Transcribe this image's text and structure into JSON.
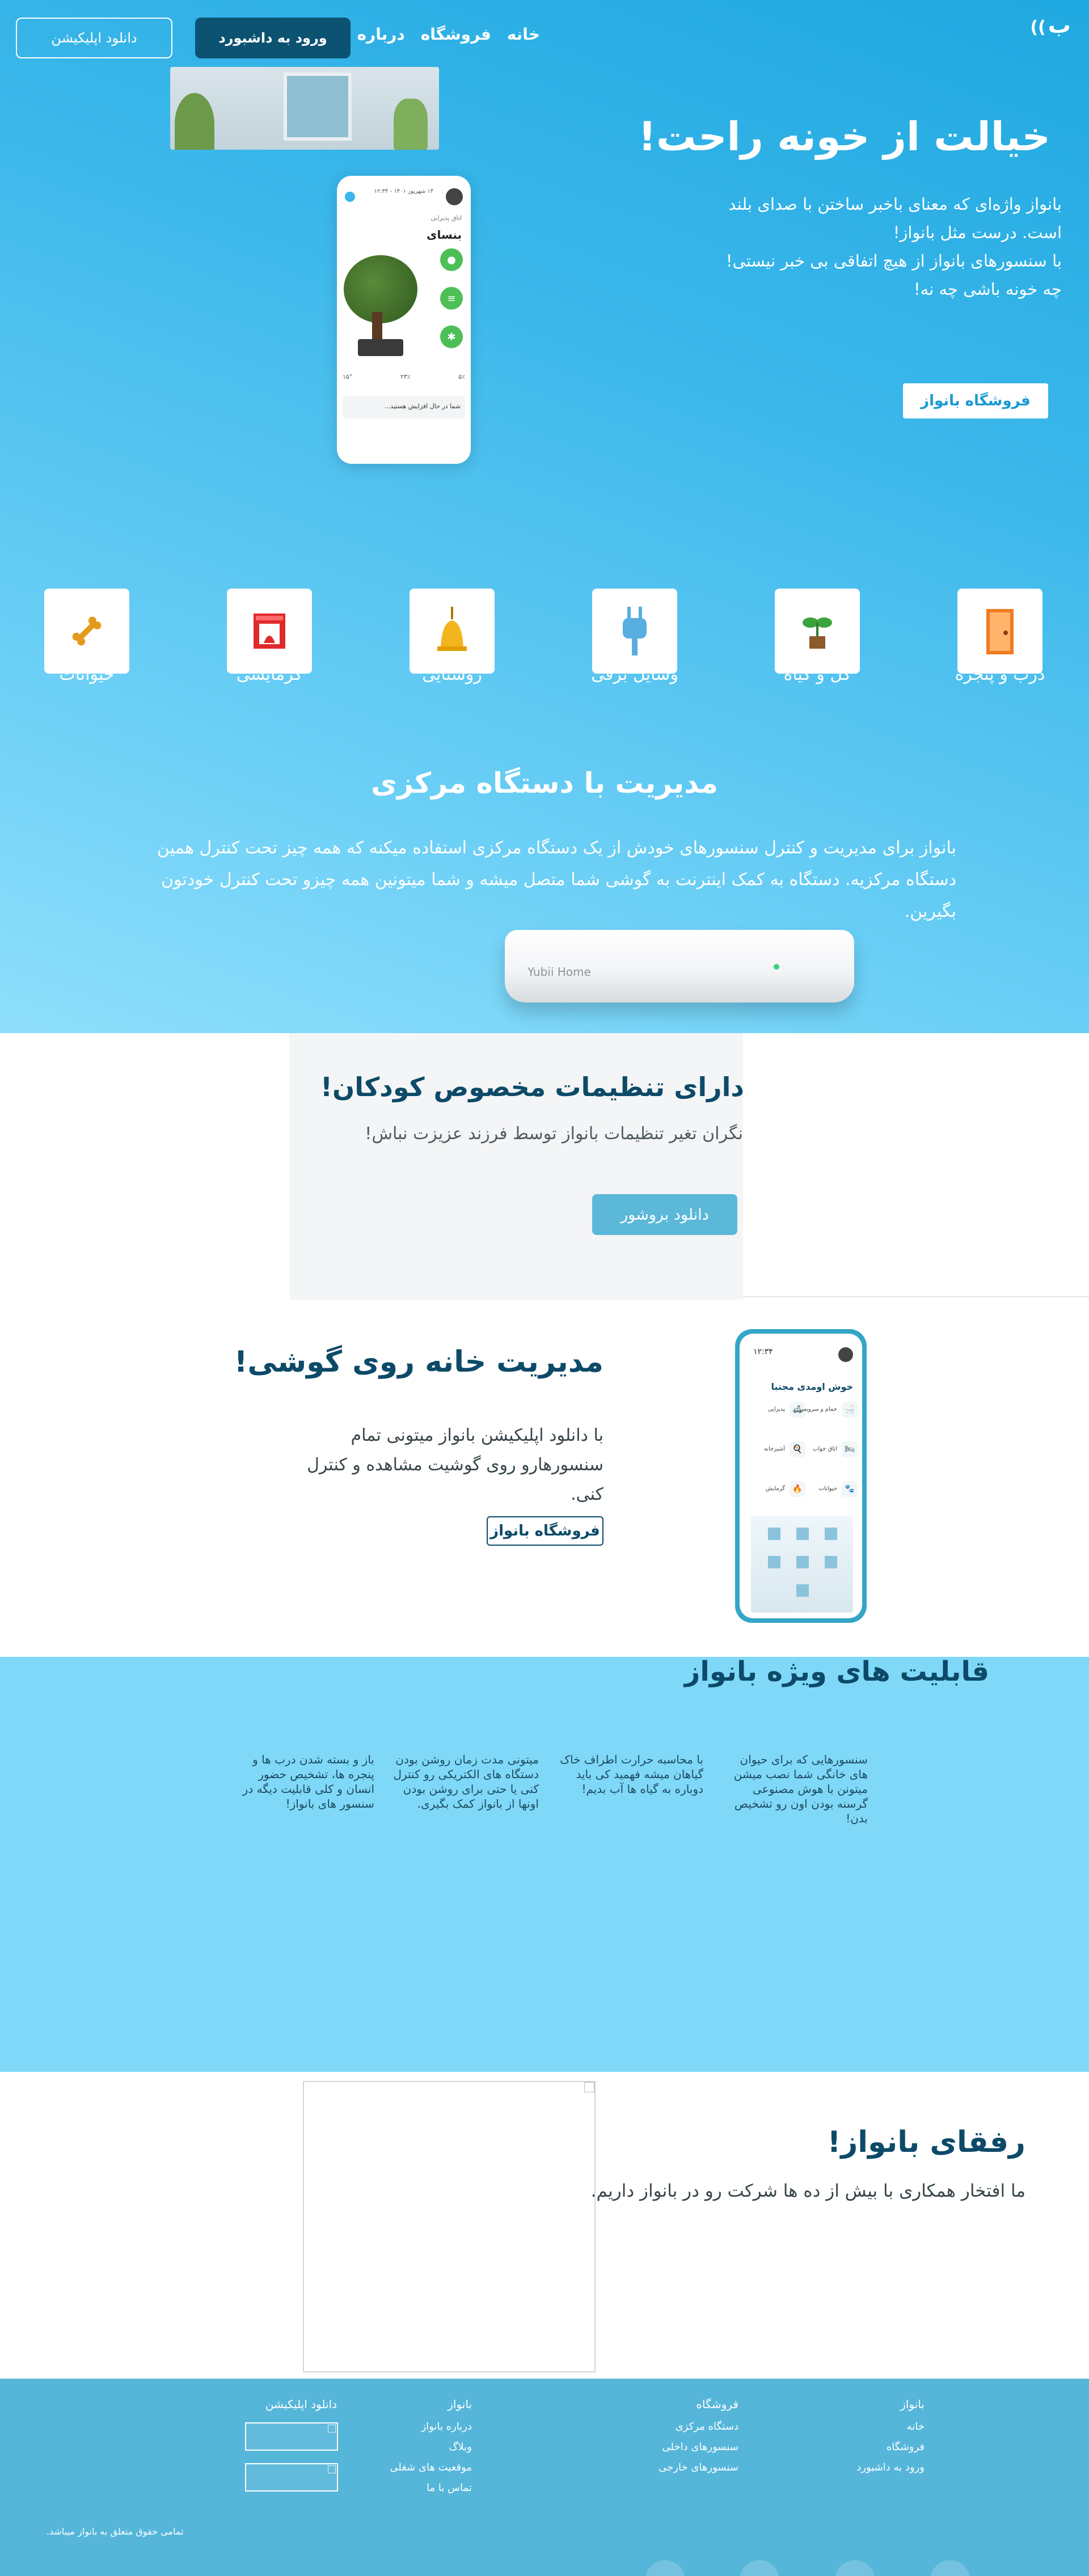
{
  "header": {
    "logo_text": "ب",
    "nav": [
      "خانه",
      "فروشگاه",
      "درباره ما"
    ],
    "dashboard_button": "ورود به داشبورد",
    "download_app_button": "دانلود اپلیکیشن"
  },
  "hero": {
    "title": "خیالت از خونه راحت!",
    "lines": [
      "بانواز واژه‌ای که معنای باخبر ساختن با صدای بلند",
      "است. درست مثل بانواز!",
      "با سنسورهای بانواز از هیچ اتفاقی بی خبر نیستی!",
      "چه خونه باشی چه نه!"
    ],
    "shop_button": "فروشگاه بانواز",
    "phone": {
      "date": "۱۴ شهریور ۱۴۰۱ - ۱۲:۳۴",
      "room": "اتاق پذیرایی",
      "plant_name": "بنسای",
      "stats": [
        "۵٪",
        "۲۳٪",
        "۱۵°"
      ],
      "note": "شما در حال افزایش هستید..."
    }
  },
  "categories": [
    {
      "label": "درب و پنجره",
      "icon": "door-icon",
      "color": "#f07b22"
    },
    {
      "label": "گل و گیاه",
      "icon": "plant-icon",
      "color": "#3aa43a"
    },
    {
      "label": "وسایل برقی",
      "icon": "plug-icon",
      "color": "#59aee0"
    },
    {
      "label": "روشنایی",
      "icon": "bell-lamp-icon",
      "color": "#f2b51e"
    },
    {
      "label": "گرمایشی",
      "icon": "heater-icon",
      "color": "#e02a2a"
    },
    {
      "label": "حیوانات",
      "icon": "bone-icon",
      "color": "#e49a1a"
    }
  ],
  "central": {
    "title": "مدیریت با دستگاه مرکزی",
    "text": "بانواز برای مدیریت و کنترل سنسورهای خودش از یک دستگاه مرکزی استفاده میکنه که همه چیز تحت کنترل همین دستگاه مرکزیه. دستگاه به کمک اینترنت به گوشی شما متصل میشه و شما میتونین همه چیزو تحت کنترل خودتون بگیرین.",
    "hub_brand": "Yubii Home"
  },
  "kids": {
    "title": "دارای تنظیمات مخصوص کودکان!",
    "text": "نگران تغیر تنظیمات بانواز توسط فرزند عزیزت نباش!",
    "button": "دانلود بروشور"
  },
  "mobile": {
    "title": "مدیریت خانه روی گوشی!",
    "line1": "با دانلود اپلیکیشن بانواز میتونی تمام",
    "line2": "سنسورهارو روی گوشیت مشاهده و کنترل کنی.",
    "button": "فروشگاه بانواز",
    "phone": {
      "time": "۱۲:۳۴",
      "greeting": "خوش اومدی مجتبا",
      "items": [
        "پذیرایی",
        "حمام و سرویس",
        "آشپزخانه",
        "اتاق خواب",
        "گرمایش",
        "حیوانات"
      ]
    }
  },
  "features": {
    "title": "قابلیت های ویژه بانواز",
    "items": [
      "سنسورهایی که برای حیوان های خانگی شما نصب میشن میتونن با هوش مصنوعی گرسنه بودن اون رو تشخیص بدن!",
      "با محاسبه حرارت اطراف خاک گیاهان میشه فهمید کی باید دوباره به گیاه ها آب بدیم!",
      "میتونی مدت زمان روشن بودن دستگاه های الکتریکی رو کنترل کنی یا حتی برای روشن بودن اونها از بانواز کمک بگیری.",
      "باز و بسته شدن درب ها و پنجره ها، تشخیص حضور انسان و کلی قابلیت دیگه در سنسور های بانواز!"
    ]
  },
  "partners": {
    "title": "رفقای بانواز!",
    "text": "ما افتخار همکاری با بیش از ده ها شرکت رو در بانواز داریم."
  },
  "footer": {
    "col1": {
      "title": "بانواز",
      "links": [
        "خانه",
        "فروشگاه",
        "ورود به داشبورد"
      ]
    },
    "col2": {
      "title": "فروشگاه",
      "links": [
        "دستگاه مرکزی",
        "سنسورهای داخلی",
        "سنسورهای خارجی"
      ]
    },
    "col3": {
      "title": "بانواز",
      "links": [
        "درباره بانواز",
        "وبلاگ",
        "موقعیت های شغلی",
        "تماس با ما"
      ]
    },
    "col4": {
      "title": "دانلود اپلیکیشن"
    },
    "copyright": "تمامی حقوق متعلق به بانواز میباشد."
  }
}
